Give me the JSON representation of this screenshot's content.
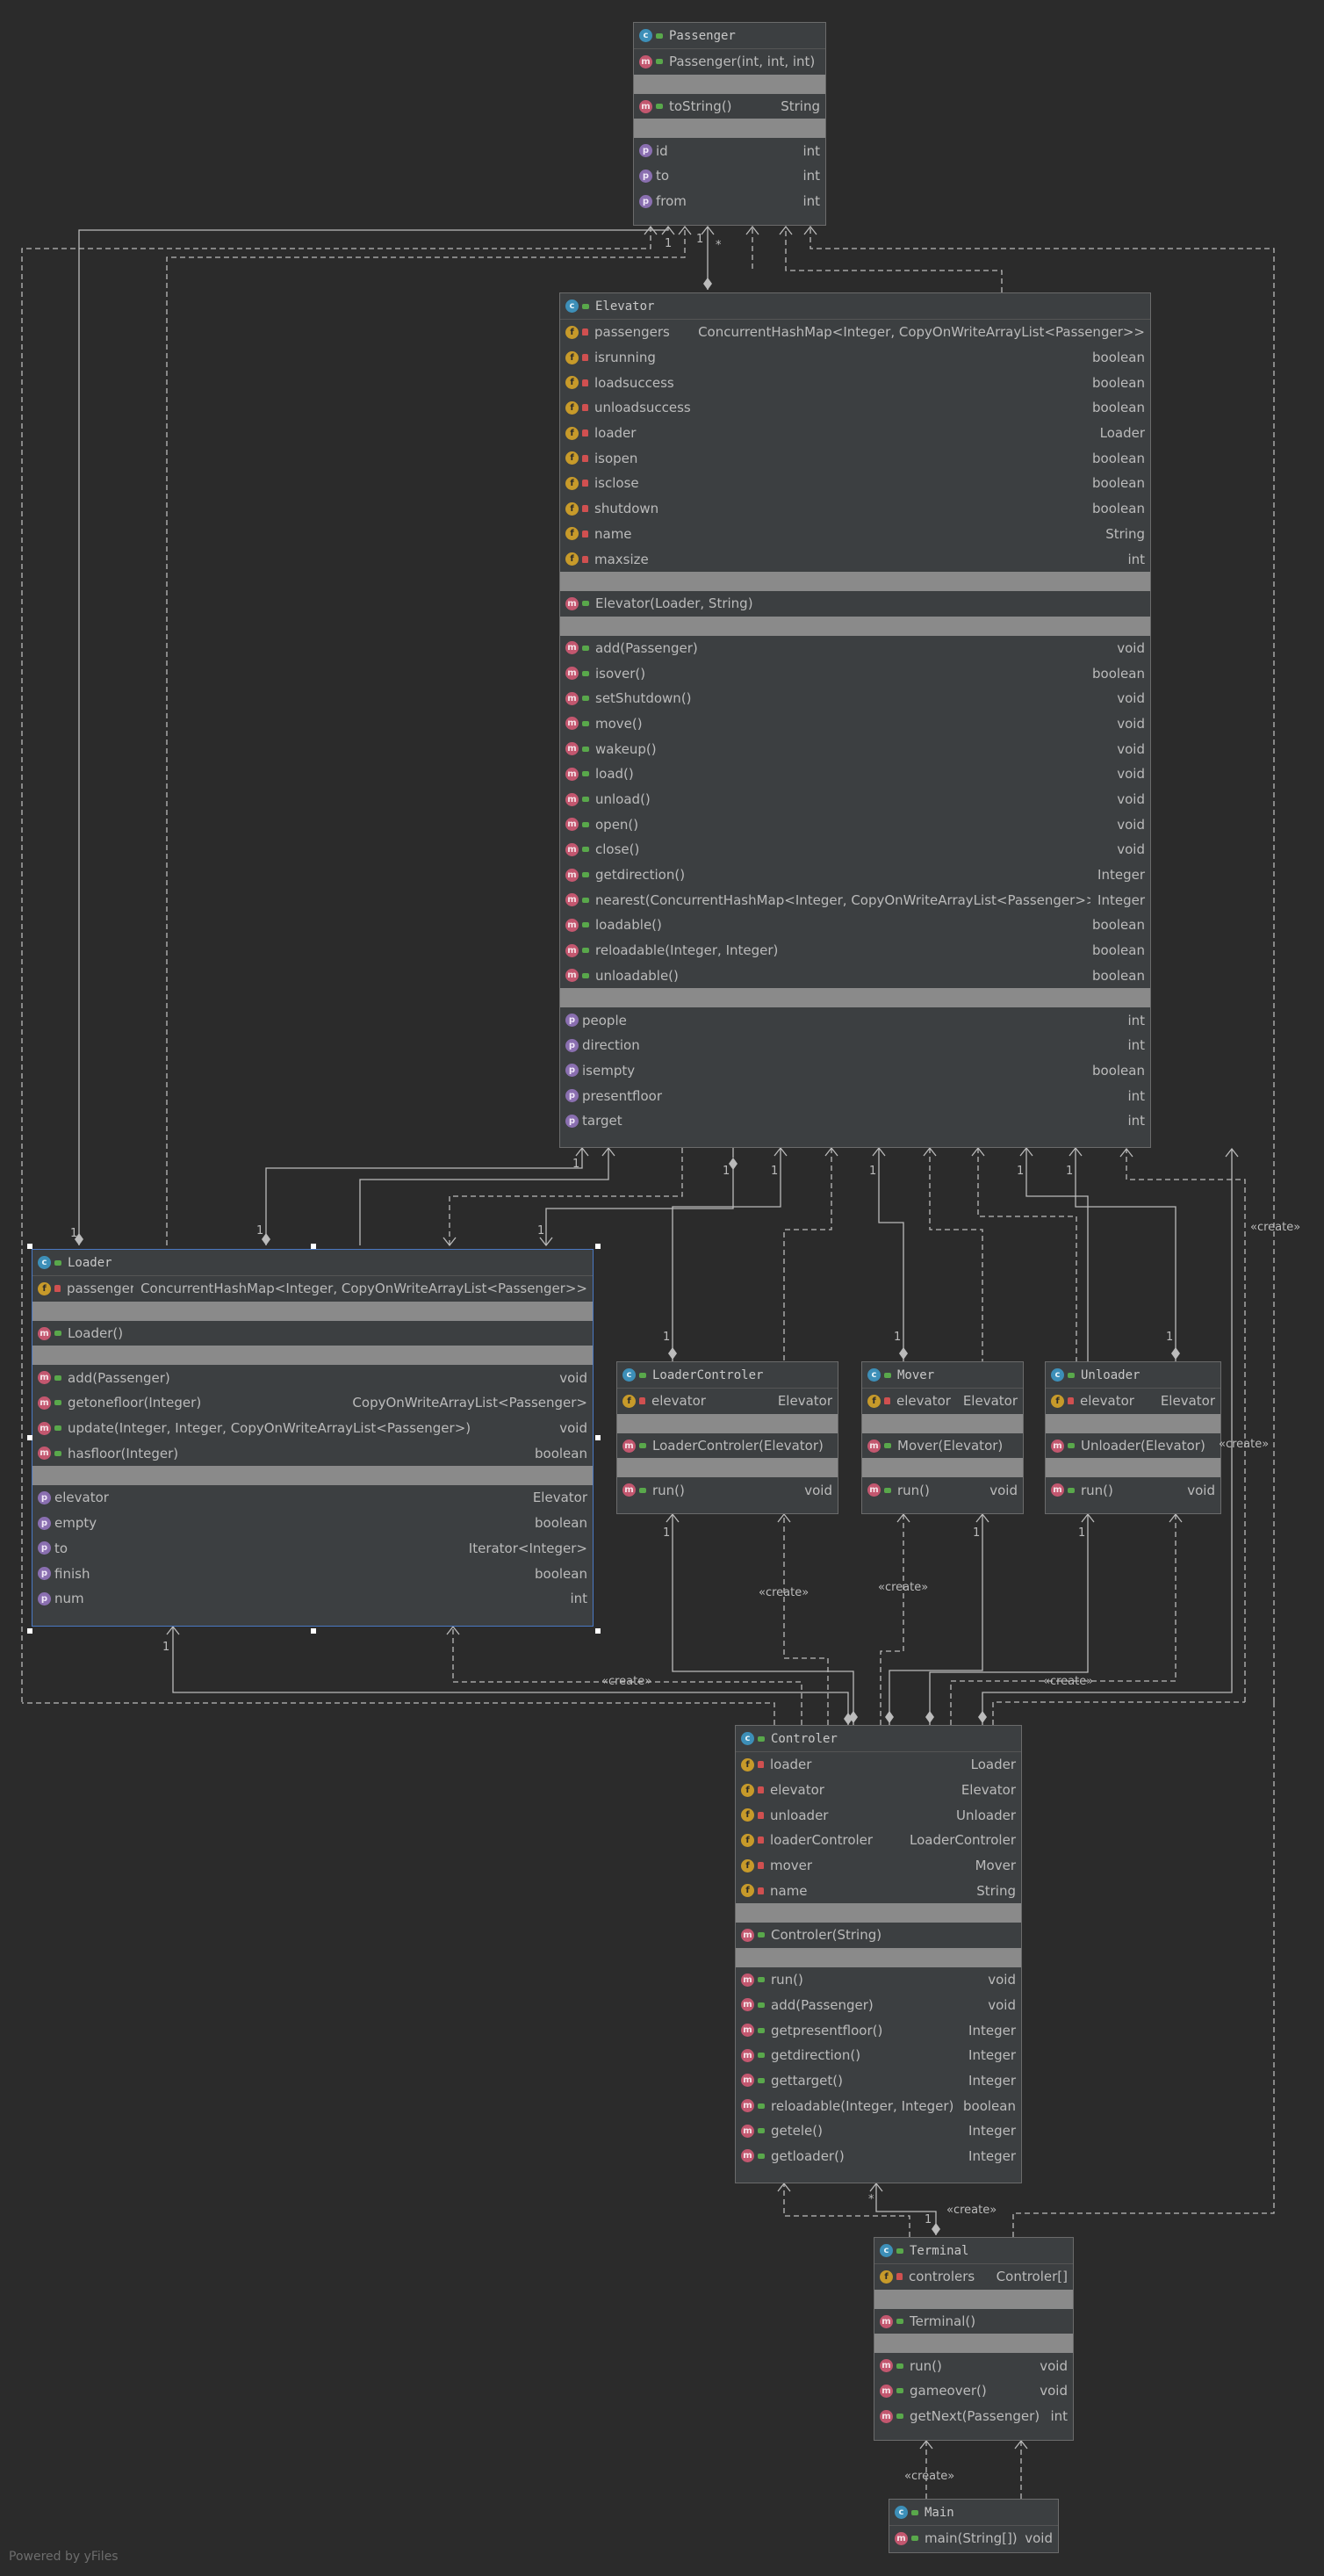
{
  "footer": "Powered by yFiles",
  "labels": {
    "create": "«create»",
    "one": "1",
    "many": "*"
  },
  "colors": {
    "background": "#2b2b2b",
    "node_fill": "#3c3f41",
    "node_border": "#6b6b6b",
    "selected_border": "#4a78c2",
    "separator": "#8a8a8a",
    "edge": "#bbbbbb"
  },
  "icons": {
    "class": "class-icon",
    "method": "method-icon",
    "field": "field-icon",
    "property": "property-icon",
    "public": "public-visibility-icon",
    "private": "private-visibility-icon",
    "main": "main-class-icon"
  },
  "classes": [
    {
      "id": "passenger",
      "name": "Passenger",
      "sections": [
        [
          {
            "kind": "m",
            "vis": "pub",
            "name": "Passenger(int, int, int)",
            "type": ""
          }
        ],
        [
          {
            "kind": "m",
            "vis": "pub",
            "name": "toString()",
            "type": "String"
          }
        ],
        [
          {
            "kind": "p",
            "vis": "",
            "name": "id",
            "type": "int"
          },
          {
            "kind": "p",
            "vis": "",
            "name": "to",
            "type": "int"
          },
          {
            "kind": "p",
            "vis": "",
            "name": "from",
            "type": "int"
          }
        ]
      ]
    },
    {
      "id": "elevator",
      "name": "Elevator",
      "sections": [
        [
          {
            "kind": "f",
            "vis": "priv",
            "name": "passengers",
            "type": "ConcurrentHashMap<Integer, CopyOnWriteArrayList<Passenger>>"
          },
          {
            "kind": "f",
            "vis": "priv",
            "name": "isrunning",
            "type": "boolean"
          },
          {
            "kind": "f",
            "vis": "priv",
            "name": "loadsuccess",
            "type": "boolean"
          },
          {
            "kind": "f",
            "vis": "priv",
            "name": "unloadsuccess",
            "type": "boolean"
          },
          {
            "kind": "f",
            "vis": "priv",
            "name": "loader",
            "type": "Loader"
          },
          {
            "kind": "f",
            "vis": "priv",
            "name": "isopen",
            "type": "boolean"
          },
          {
            "kind": "f",
            "vis": "priv",
            "name": "isclose",
            "type": "boolean"
          },
          {
            "kind": "f",
            "vis": "priv",
            "name": "shutdown",
            "type": "boolean"
          },
          {
            "kind": "f",
            "vis": "priv",
            "name": "name",
            "type": "String"
          },
          {
            "kind": "f",
            "vis": "priv",
            "name": "maxsize",
            "type": "int"
          }
        ],
        [
          {
            "kind": "m",
            "vis": "pub",
            "name": "Elevator(Loader, String)",
            "type": ""
          }
        ],
        [
          {
            "kind": "m",
            "vis": "pub",
            "name": "add(Passenger)",
            "type": "void"
          },
          {
            "kind": "m",
            "vis": "pub",
            "name": "isover()",
            "type": "boolean"
          },
          {
            "kind": "m",
            "vis": "pub",
            "name": "setShutdown()",
            "type": "void"
          },
          {
            "kind": "m",
            "vis": "pub",
            "name": "move()",
            "type": "void"
          },
          {
            "kind": "m",
            "vis": "pub",
            "name": "wakeup()",
            "type": "void"
          },
          {
            "kind": "m",
            "vis": "pub",
            "name": "load()",
            "type": "void"
          },
          {
            "kind": "m",
            "vis": "pub",
            "name": "unload()",
            "type": "void"
          },
          {
            "kind": "m",
            "vis": "pub",
            "name": "open()",
            "type": "void"
          },
          {
            "kind": "m",
            "vis": "pub",
            "name": "close()",
            "type": "void"
          },
          {
            "kind": "m",
            "vis": "pub",
            "name": "getdirection()",
            "type": "Integer"
          },
          {
            "kind": "m",
            "vis": "pub",
            "name": "nearest(ConcurrentHashMap<Integer, CopyOnWriteArrayList<Passenger>>)",
            "type": "Integer"
          },
          {
            "kind": "m",
            "vis": "pub",
            "name": "loadable()",
            "type": "boolean"
          },
          {
            "kind": "m",
            "vis": "pub",
            "name": "reloadable(Integer, Integer)",
            "type": "boolean"
          },
          {
            "kind": "m",
            "vis": "pub",
            "name": "unloadable()",
            "type": "boolean"
          }
        ],
        [
          {
            "kind": "p",
            "vis": "",
            "name": "people",
            "type": "int"
          },
          {
            "kind": "p",
            "vis": "",
            "name": "direction",
            "type": "int"
          },
          {
            "kind": "p",
            "vis": "",
            "name": "isempty",
            "type": "boolean"
          },
          {
            "kind": "p",
            "vis": "",
            "name": "presentfloor",
            "type": "int"
          },
          {
            "kind": "p",
            "vis": "",
            "name": "target",
            "type": "int"
          }
        ]
      ]
    },
    {
      "id": "loader",
      "name": "Loader",
      "selected": true,
      "sections": [
        [
          {
            "kind": "f",
            "vis": "priv",
            "name": "passengers",
            "type": "ConcurrentHashMap<Integer, CopyOnWriteArrayList<Passenger>>"
          }
        ],
        [
          {
            "kind": "m",
            "vis": "pub",
            "name": "Loader()",
            "type": ""
          }
        ],
        [
          {
            "kind": "m",
            "vis": "pub",
            "name": "add(Passenger)",
            "type": "void"
          },
          {
            "kind": "m",
            "vis": "pub",
            "name": "getonefloor(Integer)",
            "type": "CopyOnWriteArrayList<Passenger>"
          },
          {
            "kind": "m",
            "vis": "pub",
            "name": "update(Integer, Integer, CopyOnWriteArrayList<Passenger>)",
            "type": "void"
          },
          {
            "kind": "m",
            "vis": "pub",
            "name": "hasfloor(Integer)",
            "type": "boolean"
          }
        ],
        [
          {
            "kind": "p",
            "vis": "",
            "name": "elevator",
            "type": "Elevator"
          },
          {
            "kind": "p",
            "vis": "",
            "name": "empty",
            "type": "boolean"
          },
          {
            "kind": "p",
            "vis": "",
            "name": "to",
            "type": "Iterator<Integer>"
          },
          {
            "kind": "p",
            "vis": "",
            "name": "finish",
            "type": "boolean"
          },
          {
            "kind": "p",
            "vis": "",
            "name": "num",
            "type": "int"
          }
        ]
      ]
    },
    {
      "id": "loadercontroler",
      "name": "LoaderControler",
      "sections": [
        [
          {
            "kind": "f",
            "vis": "priv",
            "name": "elevator",
            "type": "Elevator"
          }
        ],
        [
          {
            "kind": "m",
            "vis": "pub",
            "name": "LoaderControler(Elevator)",
            "type": ""
          }
        ],
        [
          {
            "kind": "m",
            "vis": "pub",
            "name": "run()",
            "type": "void"
          }
        ]
      ]
    },
    {
      "id": "mover",
      "name": "Mover",
      "sections": [
        [
          {
            "kind": "f",
            "vis": "priv",
            "name": "elevator",
            "type": "Elevator"
          }
        ],
        [
          {
            "kind": "m",
            "vis": "pub",
            "name": "Mover(Elevator)",
            "type": ""
          }
        ],
        [
          {
            "kind": "m",
            "vis": "pub",
            "name": "run()",
            "type": "void"
          }
        ]
      ]
    },
    {
      "id": "unloader",
      "name": "Unloader",
      "sections": [
        [
          {
            "kind": "f",
            "vis": "priv",
            "name": "elevator",
            "type": "Elevator"
          }
        ],
        [
          {
            "kind": "m",
            "vis": "pub",
            "name": "Unloader(Elevator)",
            "type": ""
          }
        ],
        [
          {
            "kind": "m",
            "vis": "pub",
            "name": "run()",
            "type": "void"
          }
        ]
      ]
    },
    {
      "id": "controler",
      "name": "Controler",
      "sections": [
        [
          {
            "kind": "f",
            "vis": "priv",
            "name": "loader",
            "type": "Loader"
          },
          {
            "kind": "f",
            "vis": "priv",
            "name": "elevator",
            "type": "Elevator"
          },
          {
            "kind": "f",
            "vis": "priv",
            "name": "unloader",
            "type": "Unloader"
          },
          {
            "kind": "f",
            "vis": "priv",
            "name": "loaderControler",
            "type": "LoaderControler"
          },
          {
            "kind": "f",
            "vis": "priv",
            "name": "mover",
            "type": "Mover"
          },
          {
            "kind": "f",
            "vis": "priv",
            "name": "name",
            "type": "String"
          }
        ],
        [
          {
            "kind": "m",
            "vis": "pub",
            "name": "Controler(String)",
            "type": ""
          }
        ],
        [
          {
            "kind": "m",
            "vis": "pub",
            "name": "run()",
            "type": "void"
          },
          {
            "kind": "m",
            "vis": "pub",
            "name": "add(Passenger)",
            "type": "void"
          },
          {
            "kind": "m",
            "vis": "pub",
            "name": "getpresentfloor()",
            "type": "Integer"
          },
          {
            "kind": "m",
            "vis": "pub",
            "name": "getdirection()",
            "type": "Integer"
          },
          {
            "kind": "m",
            "vis": "pub",
            "name": "gettarget()",
            "type": "Integer"
          },
          {
            "kind": "m",
            "vis": "pub",
            "name": "reloadable(Integer, Integer)",
            "type": "boolean"
          },
          {
            "kind": "m",
            "vis": "pub",
            "name": "getele()",
            "type": "Integer"
          },
          {
            "kind": "m",
            "vis": "pub",
            "name": "getloader()",
            "type": "Integer"
          }
        ]
      ]
    },
    {
      "id": "terminal",
      "name": "Terminal",
      "sections": [
        [
          {
            "kind": "f",
            "vis": "priv",
            "name": "controlers",
            "type": "Controler[]"
          }
        ],
        [
          {
            "kind": "m",
            "vis": "pub",
            "name": "Terminal()",
            "type": ""
          }
        ],
        [
          {
            "kind": "m",
            "vis": "pub",
            "name": "run()",
            "type": "void"
          },
          {
            "kind": "m",
            "vis": "pub",
            "name": "gameover()",
            "type": "void"
          },
          {
            "kind": "m",
            "vis": "pub",
            "name": "getNext(Passenger)",
            "type": "int"
          }
        ]
      ]
    },
    {
      "id": "main",
      "name": "Main",
      "main": true,
      "sections": [
        [
          {
            "kind": "m",
            "vis": "pub",
            "name": "main(String[])",
            "type": "void"
          }
        ]
      ]
    }
  ]
}
